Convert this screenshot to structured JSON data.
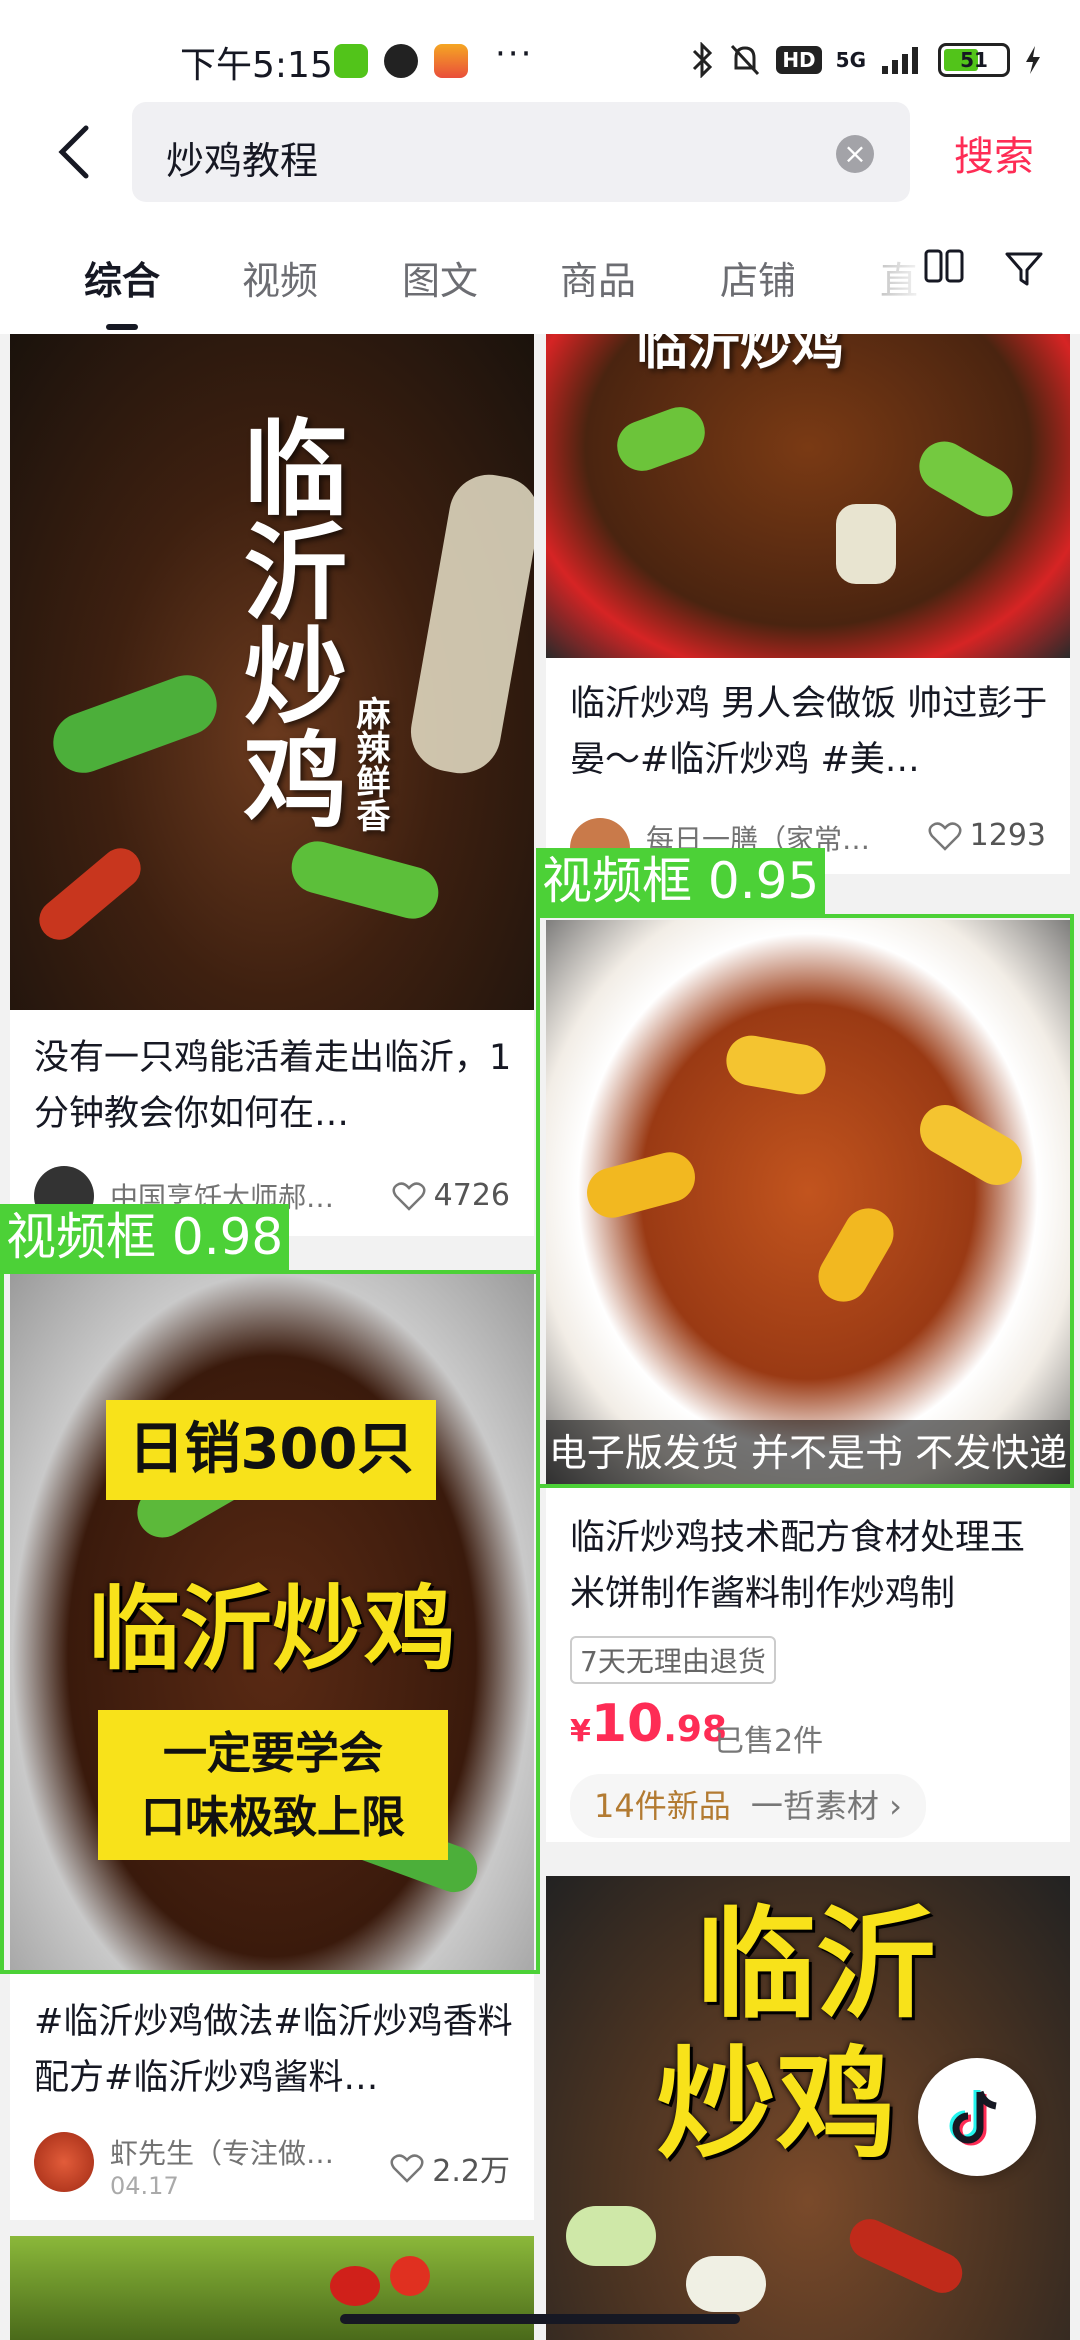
{
  "status_bar": {
    "time": "下午5:15",
    "dots": "···",
    "network": "5G",
    "hd": "HD",
    "battery": "51"
  },
  "search": {
    "query": "炒鸡教程",
    "button": "搜索"
  },
  "tabs": [
    "综合",
    "视频",
    "图文",
    "商品",
    "店铺",
    "直"
  ],
  "colors": {
    "accent": "#fe2c55",
    "detect_green": "#4cd137",
    "price_red": "#fe2c55"
  },
  "cards": {
    "left1": {
      "thumb_text": "临沂炒鸡",
      "thumb_sub": "麻辣鲜香",
      "title": "没有一只鸡能活着走出临沂，1分钟教会你如何在…",
      "author": "中国烹饪大师郝…",
      "likes": "4726"
    },
    "left2": {
      "detect_label": "视频框 0.98",
      "thumb_box1": "日销300只",
      "thumb_title": "临沂炒鸡",
      "thumb_box2_l1": "一定要学会",
      "thumb_box2_l2": "口味极致上限",
      "title": "#临沂炒鸡做法#临沂炒鸡香料配方#临沂炒鸡酱料…",
      "author": "虾先生（专注做…",
      "date": "04.17",
      "likes": "2.2万"
    },
    "right1": {
      "thumb_text": "临沂炒鸡",
      "title": "临沂炒鸡 男人会做饭 帅过彭于晏～#临沂炒鸡 #美…",
      "author": "每日一膳（家常…",
      "likes": "1293"
    },
    "right2": {
      "detect_label": "视频框 0.95",
      "banner": "电子版发货 并不是书 不发快递",
      "title": "临沂炒鸡技术配方食材处理玉米饼制作酱料制作炒鸡制",
      "tag": "7天无理由退货",
      "price_symbol": "¥",
      "price_int": "10",
      "price_dec": ".98",
      "sold": "已售2件",
      "new_items": "14件新品",
      "shop": "一哲素材",
      "shop_arrow": "›"
    },
    "right3": {
      "thumb_l1": "临沂",
      "thumb_l2": "炒鸡"
    }
  }
}
